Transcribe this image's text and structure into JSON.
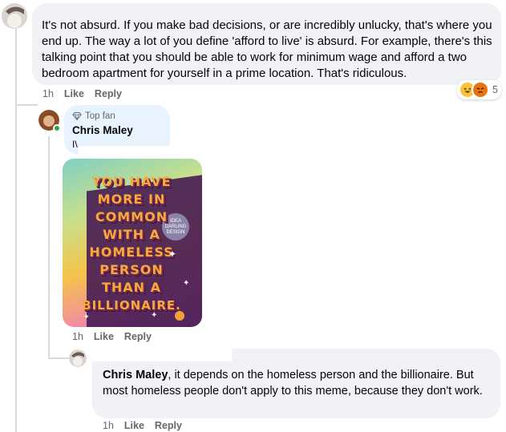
{
  "comment1": {
    "text": "It's not absurd. If you make bad decisions, or are incredibly unlucky, that's where you end up. The way a lot of you define 'afford to live' is absurd. For example, there's this talking point that you should be able to work for minimum wage and afford a two bedroom apartment for yourself in a prime location. That's ridiculous.",
    "time": "1h",
    "like": "Like",
    "reply": "Reply",
    "reaction_count": "5",
    "reaction_icons": [
      "haha-icon",
      "angry-icon"
    ]
  },
  "reply1": {
    "badge": "Top fan",
    "author": "Chris Maley",
    "partial_text": "I\\",
    "time": "1h",
    "like": "Like",
    "reply": "Reply",
    "meme": {
      "lines": [
        "YOU HAVE",
        "MORE IN",
        "COMMON",
        "WITH A",
        "HOMELESS",
        "PERSON",
        "THAN A",
        "BILLIONAIRE."
      ],
      "stamp": "IDEA DARLING DESIGN"
    }
  },
  "reply2": {
    "mention": "Chris Maley",
    "text": ", it depends on the homeless person and the billionaire. But most homeless people don't apply to this meme, because they don't work.",
    "time": "1h",
    "like": "Like",
    "reply": "Reply"
  },
  "colors": {
    "bubble": "#f0f2f5",
    "reply_bubble": "#e7f3ff",
    "secondary_text": "#65676b",
    "online": "#31a24c"
  }
}
